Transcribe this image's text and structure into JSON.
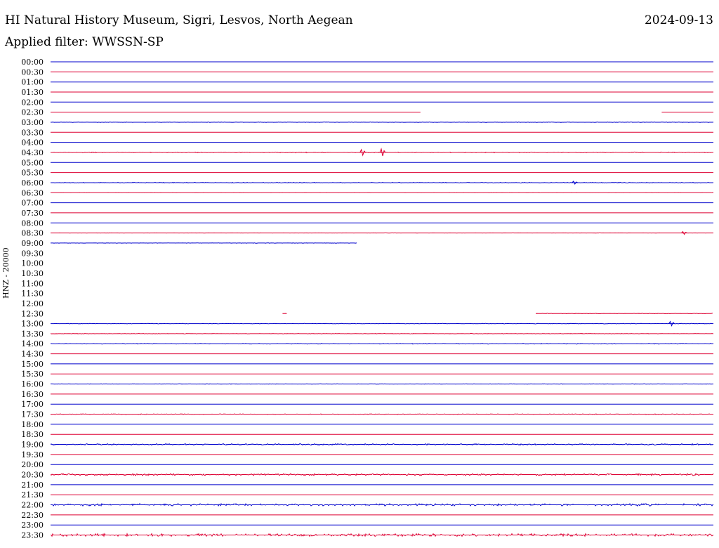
{
  "header": {
    "title": "HI Natural History Museum, Sigri, Lesvos, North Aegean",
    "date": "2024-09-13",
    "filter": "Applied filter: WWSSN-SP"
  },
  "chart_data": {
    "type": "line",
    "title": "HI Natural History Museum, Sigri, Lesvos, North Aegean",
    "ylabel": "HNZ - 20000",
    "colors": {
      "odd": "#0000cc",
      "even": "#dd0033"
    },
    "traces": [
      {
        "label": "00:00",
        "segments": [
          [
            0,
            1
          ]
        ],
        "noise": 0
      },
      {
        "label": "00:30",
        "segments": [
          [
            0,
            1
          ]
        ],
        "noise": 0
      },
      {
        "label": "01:00",
        "segments": [
          [
            0,
            1
          ]
        ],
        "noise": 0
      },
      {
        "label": "01:30",
        "segments": [
          [
            0,
            1
          ]
        ],
        "noise": 0
      },
      {
        "label": "02:00",
        "segments": [
          [
            0,
            1
          ]
        ],
        "noise": 0
      },
      {
        "label": "02:30",
        "segments": [
          [
            0,
            0.558
          ],
          [
            0.922,
            1
          ]
        ],
        "noise": 0
      },
      {
        "label": "03:00",
        "segments": [
          [
            0,
            1
          ]
        ],
        "noise": 0.3
      },
      {
        "label": "03:30",
        "segments": [
          [
            0,
            1
          ]
        ],
        "noise": 0
      },
      {
        "label": "04:00",
        "segments": [
          [
            0,
            1
          ]
        ],
        "noise": 0
      },
      {
        "label": "04:30",
        "segments": [
          [
            0,
            1
          ]
        ],
        "noise": 0.6,
        "events": [
          [
            0.47,
            4
          ],
          [
            0.5,
            5
          ]
        ]
      },
      {
        "label": "05:00",
        "segments": [
          [
            0,
            1
          ]
        ],
        "noise": 0
      },
      {
        "label": "05:30",
        "segments": [
          [
            0,
            1
          ]
        ],
        "noise": 0
      },
      {
        "label": "06:00",
        "segments": [
          [
            0,
            1
          ]
        ],
        "noise": 0.5,
        "events": [
          [
            0.79,
            2
          ]
        ]
      },
      {
        "label": "06:30",
        "segments": [
          [
            0,
            1
          ]
        ],
        "noise": 0.2
      },
      {
        "label": "07:00",
        "segments": [
          [
            0,
            1
          ]
        ],
        "noise": 0
      },
      {
        "label": "07:30",
        "segments": [
          [
            0,
            1
          ]
        ],
        "noise": 0
      },
      {
        "label": "08:00",
        "segments": [
          [
            0,
            1
          ]
        ],
        "noise": 0
      },
      {
        "label": "08:30",
        "segments": [
          [
            0,
            1
          ]
        ],
        "noise": 0.1,
        "events": [
          [
            0.955,
            2
          ]
        ]
      },
      {
        "label": "09:00",
        "segments": [
          [
            0,
            0.462
          ]
        ],
        "noise": 0.3
      },
      {
        "label": "09:30",
        "segments": [],
        "noise": 0
      },
      {
        "label": "10:00",
        "segments": [],
        "noise": 0
      },
      {
        "label": "10:30",
        "segments": [],
        "noise": 0
      },
      {
        "label": "11:00",
        "segments": [],
        "noise": 0
      },
      {
        "label": "11:30",
        "segments": [],
        "noise": 0
      },
      {
        "label": "12:00",
        "segments": [],
        "noise": 0
      },
      {
        "label": "12:30",
        "segments": [
          [
            0.35,
            0.357
          ],
          [
            0.732,
            1
          ]
        ],
        "noise": 0.4
      },
      {
        "label": "13:00",
        "segments": [
          [
            0,
            1
          ]
        ],
        "noise": 0.4,
        "events": [
          [
            0.936,
            3
          ]
        ]
      },
      {
        "label": "13:30",
        "segments": [
          [
            0,
            1
          ]
        ],
        "noise": 0.4
      },
      {
        "label": "14:00",
        "segments": [
          [
            0,
            1
          ]
        ],
        "noise": 0.6
      },
      {
        "label": "14:30",
        "segments": [
          [
            0,
            1
          ]
        ],
        "noise": 0
      },
      {
        "label": "15:00",
        "segments": [
          [
            0,
            1
          ]
        ],
        "noise": 0
      },
      {
        "label": "15:30",
        "segments": [
          [
            0,
            1
          ]
        ],
        "noise": 0
      },
      {
        "label": "16:00",
        "segments": [
          [
            0,
            1
          ]
        ],
        "noise": 0.3
      },
      {
        "label": "16:30",
        "segments": [
          [
            0,
            1
          ]
        ],
        "noise": 0
      },
      {
        "label": "17:00",
        "segments": [
          [
            0,
            1
          ]
        ],
        "noise": 0
      },
      {
        "label": "17:30",
        "segments": [
          [
            0,
            1
          ]
        ],
        "noise": 0.5
      },
      {
        "label": "18:00",
        "segments": [
          [
            0,
            1
          ]
        ],
        "noise": 0
      },
      {
        "label": "18:30",
        "segments": [
          [
            0,
            1
          ]
        ],
        "noise": 0
      },
      {
        "label": "19:00",
        "segments": [
          [
            0,
            1
          ]
        ],
        "noise": 1.0
      },
      {
        "label": "19:30",
        "segments": [
          [
            0,
            1
          ]
        ],
        "noise": 0
      },
      {
        "label": "20:00",
        "segments": [
          [
            0,
            1
          ]
        ],
        "noise": 0
      },
      {
        "label": "20:30",
        "segments": [
          [
            0,
            1
          ]
        ],
        "noise": 1.4
      },
      {
        "label": "21:00",
        "segments": [
          [
            0,
            1
          ]
        ],
        "noise": 0
      },
      {
        "label": "21:30",
        "segments": [
          [
            0,
            1
          ]
        ],
        "noise": 0
      },
      {
        "label": "22:00",
        "segments": [
          [
            0,
            1
          ]
        ],
        "noise": 1.6
      },
      {
        "label": "22:30",
        "segments": [
          [
            0,
            1
          ]
        ],
        "noise": 0
      },
      {
        "label": "23:00",
        "segments": [
          [
            0,
            1
          ]
        ],
        "noise": 0
      },
      {
        "label": "23:30",
        "segments": [
          [
            0,
            1
          ]
        ],
        "noise": 1.8
      }
    ]
  }
}
